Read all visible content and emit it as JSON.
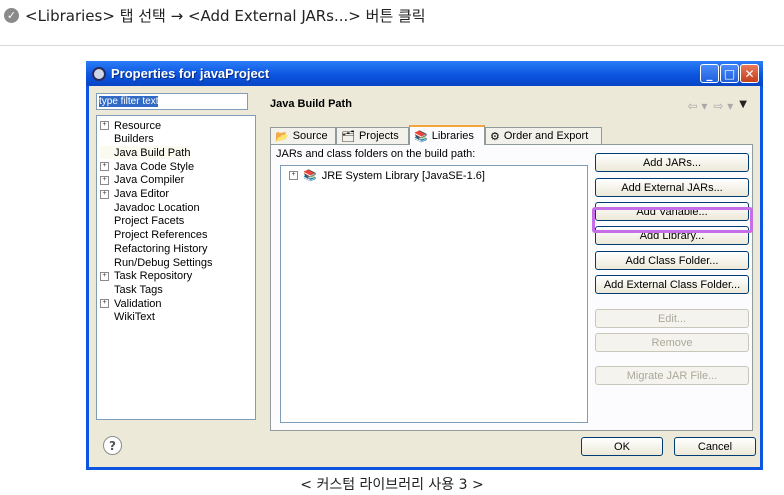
{
  "instruction": {
    "icon": "check-circle-icon",
    "text": "<Libraries> 탭 선택 → <Add External JARs...> 버튼 클릭"
  },
  "window": {
    "title": "Properties for javaProject",
    "filter_placeholder": "type filter text",
    "tree": [
      {
        "label": "Resource",
        "expandable": true
      },
      {
        "label": "Builders",
        "expandable": false
      },
      {
        "label": "Java Build Path",
        "expandable": false,
        "selected": true
      },
      {
        "label": "Java Code Style",
        "expandable": true
      },
      {
        "label": "Java Compiler",
        "expandable": true
      },
      {
        "label": "Java Editor",
        "expandable": true
      },
      {
        "label": "Javadoc Location",
        "expandable": false
      },
      {
        "label": "Project Facets",
        "expandable": false
      },
      {
        "label": "Project References",
        "expandable": false
      },
      {
        "label": "Refactoring History",
        "expandable": false
      },
      {
        "label": "Run/Debug Settings",
        "expandable": false
      },
      {
        "label": "Task Repository",
        "expandable": true
      },
      {
        "label": "Task Tags",
        "expandable": false
      },
      {
        "label": "Validation",
        "expandable": true
      },
      {
        "label": "WikiText",
        "expandable": false
      }
    ],
    "page_title": "Java Build Path",
    "tabs": [
      {
        "label": "Source",
        "icon": "source-folder-icon"
      },
      {
        "label": "Projects",
        "icon": "projects-icon"
      },
      {
        "label": "Libraries",
        "icon": "books-icon",
        "active": true
      },
      {
        "label": "Order and Export",
        "icon": "order-export-icon"
      }
    ],
    "panel_desc": "JARs and class folders on the build path:",
    "libraries": [
      {
        "label": "JRE System Library [JavaSE-1.6]"
      }
    ],
    "buttons": [
      {
        "label": "Add JARs...",
        "enabled": true
      },
      {
        "label": "Add External JARs...",
        "enabled": true,
        "highlighted": true
      },
      {
        "label": "Add Variable...",
        "enabled": true
      },
      {
        "label": "Add Library...",
        "enabled": true
      },
      {
        "label": "Add Class Folder...",
        "enabled": true
      },
      {
        "label": "Add External Class Folder...",
        "enabled": true
      },
      {
        "label": "Edit...",
        "enabled": false
      },
      {
        "label": "Remove",
        "enabled": false
      },
      {
        "label": "Migrate JAR File...",
        "enabled": false
      }
    ],
    "ok_label": "OK",
    "cancel_label": "Cancel",
    "highlight_color": "#c66de8"
  },
  "caption": "< 커스텀 라이브러리 사용 3 >"
}
